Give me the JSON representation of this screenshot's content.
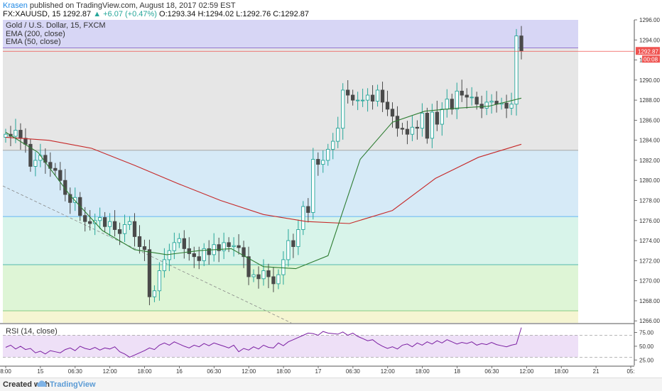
{
  "header": {
    "author": "Krasen",
    "published_text": " published on TradingView.com, August 18, 2017 02:59 EST",
    "symbol_line": "FX:XAUUSD, 15  1292.87 ",
    "change": "▲ +6.07 (+0.47%)",
    "ohlc": " O:1293.34  H:1294.02  L:1292.76  C:1292.87"
  },
  "legend": {
    "title": "Gold / U.S. Dollar, 15, FXCM",
    "ema200": "EMA (200, close)",
    "ema50": "EMA (50, close)"
  },
  "rsi": {
    "label": "RSI (14, close)"
  },
  "footer": {
    "created": "Created with",
    "brand": "TradingView"
  },
  "colors": {
    "candle_up": "#26a69a",
    "candle_down": "#4a4a4a",
    "ema200": "#c62828",
    "ema50": "#2e7d32",
    "rsi": "#7b1fa2",
    "price_tag": "#ef5350"
  },
  "chart_data": {
    "type": "line",
    "title": "Gold / U.S. Dollar, 15, FXCM",
    "price_axis": {
      "ticks": [
        1266.0,
        1268.0,
        1270.0,
        1272.0,
        1274.0,
        1276.0,
        1278.0,
        1280.0,
        1282.0,
        1284.0,
        1286.0,
        1288.0,
        1290.0,
        1292.0,
        1294.0,
        1296.0
      ],
      "range": [
        1265.8,
        1296.0
      ]
    },
    "time_axis": {
      "ticks": [
        "8:00",
        "15",
        "06:30",
        "12:00",
        "18:00",
        "16",
        "06:30",
        "12:00",
        "18:00",
        "17",
        "06:30",
        "12:00",
        "18:00",
        "18",
        "06:30",
        "12:00",
        "18:00",
        "21",
        "05:"
      ]
    },
    "last_price": 1292.87,
    "countdown": "00:08",
    "fib_levels": [
      1293.2,
      1283.0,
      1276.4,
      1271.6,
      1267.0
    ],
    "fib_fills": [
      "#d7d6f5",
      "#e6e6e6",
      "#d6eaf7",
      "#d8f4ea",
      "#def5d6",
      "#f5f5d2"
    ],
    "series": [
      {
        "name": "Gold / U.S. Dollar",
        "close": [
          1284.6,
          1284.4,
          1285.0,
          1284.2,
          1283.6,
          1281.4,
          1282.0,
          1282.5,
          1281.8,
          1281.2,
          1281.0,
          1280.0,
          1278.6,
          1277.8,
          1278.3,
          1276.5,
          1275.9,
          1275.7,
          1276.0,
          1276.3,
          1275.4,
          1275.9,
          1275.1,
          1274.7,
          1275.6,
          1275.9,
          1274.4,
          1273.4,
          1273.1,
          1268.4,
          1269.0,
          1271.0,
          1272.1,
          1273.0,
          1273.8,
          1274.2,
          1273.2,
          1272.7,
          1272.4,
          1272.0,
          1273.2,
          1272.6,
          1273.6,
          1273.0,
          1273.8,
          1273.4,
          1273.5,
          1273.3,
          1272.4,
          1270.4,
          1270.6,
          1270.2,
          1271.0,
          1270.4,
          1269.7,
          1270.6,
          1272.1,
          1274.0,
          1273.4,
          1275.1,
          1277.4,
          1276.8,
          1282.1,
          1281.6,
          1282.0,
          1283.1,
          1283.9,
          1285.2,
          1289.0,
          1288.5,
          1288.0,
          1288.0,
          1288.0,
          1288.5,
          1287.9,
          1289.0,
          1287.8,
          1287.1,
          1286.4,
          1285.2,
          1285.1,
          1284.6,
          1285.3,
          1285.2,
          1286.7,
          1284.2,
          1286.8,
          1285.6,
          1287.1,
          1288.1,
          1287.1,
          1288.9,
          1288.5,
          1288.3,
          1288.3,
          1287.6,
          1287.2,
          1287.8,
          1287.9,
          1287.6,
          1287.7,
          1287.2,
          1287.6,
          1294.4,
          1292.9
        ]
      },
      {
        "name": "EMA (200, close)",
        "values": [
          1284.3,
          1284.0,
          1283.2,
          1281.5,
          1279.7,
          1278.0,
          1276.6,
          1275.9,
          1275.7,
          1277.0,
          1280.2,
          1282.3,
          1283.6
        ]
      },
      {
        "name": "EMA (50, close)",
        "values": [
          1284.8,
          1282.8,
          1278.5,
          1275.0,
          1273.1,
          1272.6,
          1273.0,
          1273.2,
          1271.4,
          1271.2,
          1272.5,
          1282.1,
          1285.8,
          1286.9,
          1287.2,
          1287.4,
          1288.2
        ]
      }
    ],
    "rsi": {
      "name": "RSI (14, close)",
      "ticks": [
        25.0,
        50.0,
        75.0
      ],
      "bands": [
        30,
        70
      ],
      "values": [
        48,
        52,
        45,
        50,
        44,
        46,
        38,
        41,
        36,
        42,
        40,
        38,
        44,
        47,
        42,
        50,
        46,
        44,
        48,
        43,
        47,
        45,
        49,
        40,
        36,
        30,
        34,
        38,
        42,
        47,
        44,
        52,
        56,
        52,
        58,
        54,
        50,
        47,
        52,
        49,
        55,
        51,
        56,
        53,
        50,
        47,
        52,
        40,
        46,
        43,
        49,
        45,
        52,
        48,
        47,
        56,
        51,
        58,
        62,
        66,
        70,
        74,
        73,
        70,
        77,
        74,
        73,
        72,
        76,
        70,
        74,
        68,
        64,
        60,
        62,
        55,
        50,
        46,
        49,
        45,
        52,
        54,
        49,
        56,
        52,
        58,
        54,
        60,
        56,
        62,
        58,
        54,
        57,
        55,
        58,
        52,
        55,
        53,
        57,
        53,
        51,
        49,
        52,
        54,
        84
      ]
    }
  }
}
